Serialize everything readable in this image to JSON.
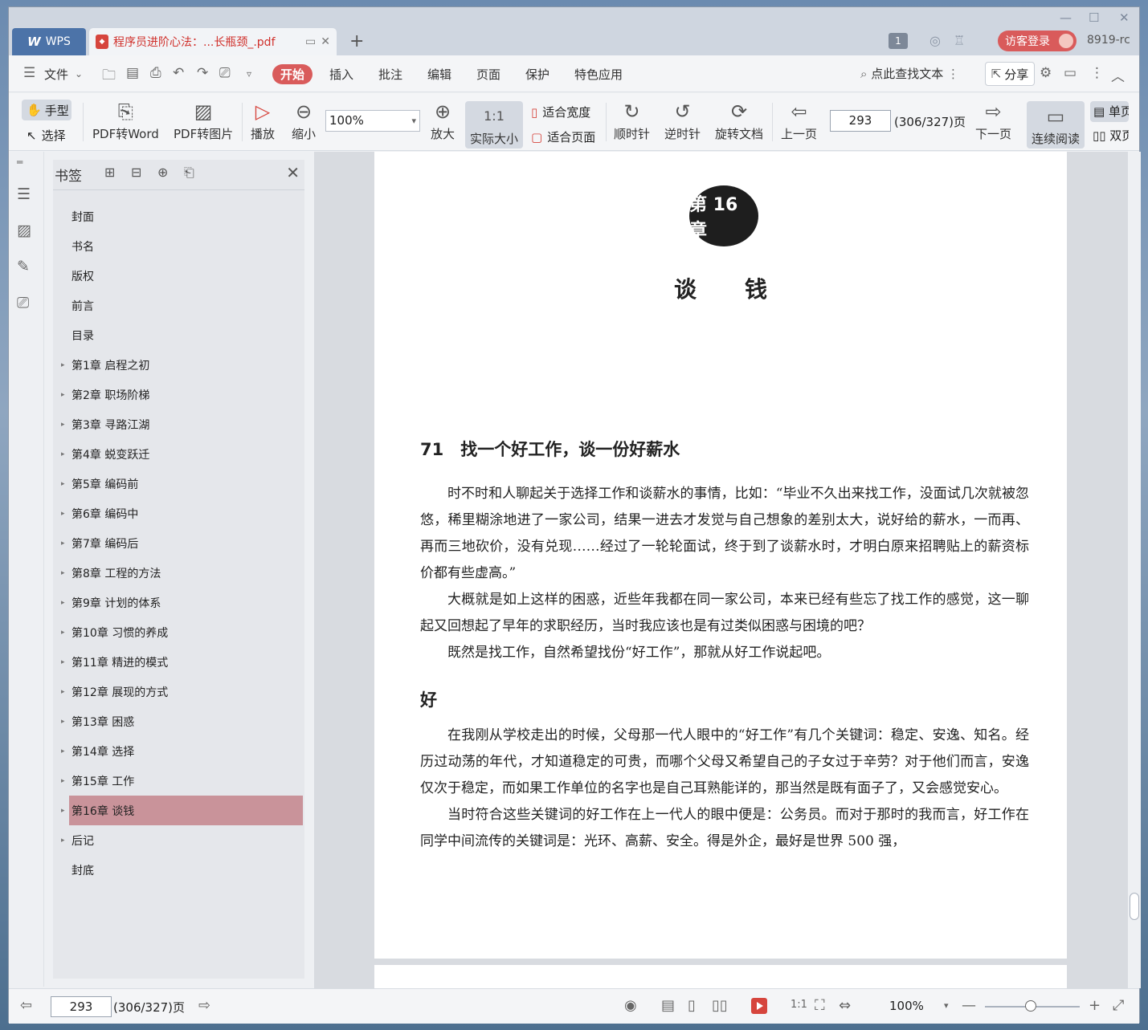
{
  "titlebar": {
    "app_tab": "WPS",
    "doc_tab_title": "程序员进阶心法：...长瓶颈_.pdf",
    "badge_count": "1",
    "visitor_login": "访客登录",
    "user_code": "8919-rc"
  },
  "menubar": {
    "file": "文件",
    "tabs": [
      "开始",
      "插入",
      "批注",
      "编辑",
      "页面",
      "保护",
      "特色应用"
    ],
    "search": "点此查找文本",
    "share": "分享"
  },
  "toolbar": {
    "hand": "手型",
    "select": "选择",
    "pdf_to_word": "PDF转Word",
    "pdf_to_image": "PDF转图片",
    "play": "播放",
    "zoom_out": "缩小",
    "zoom_value": "100%",
    "zoom_in": "放大",
    "actual_size": "实际大小",
    "fit_width": "适合宽度",
    "fit_page": "适合页面",
    "rotate_cw": "顺时针",
    "rotate_ccw": "逆时针",
    "rotate_doc": "旋转文档",
    "prev_page": "上一页",
    "page_input": "293",
    "page_total": "(306/327)页",
    "next_page": "下一页",
    "continuous": "连续阅读",
    "single": "单页",
    "double": "双页"
  },
  "panel": {
    "title": "书签",
    "items": [
      {
        "label": "封面",
        "expandable": false
      },
      {
        "label": "书名",
        "expandable": false
      },
      {
        "label": "版权",
        "expandable": false
      },
      {
        "label": "前言",
        "expandable": false
      },
      {
        "label": "目录",
        "expandable": false
      },
      {
        "label": "第1章 启程之初",
        "expandable": true
      },
      {
        "label": "第2章 职场阶梯",
        "expandable": true
      },
      {
        "label": "第3章 寻路江湖",
        "expandable": true
      },
      {
        "label": "第4章 蜕变跃迁",
        "expandable": true
      },
      {
        "label": "第5章 编码前",
        "expandable": true
      },
      {
        "label": "第6章 编码中",
        "expandable": true
      },
      {
        "label": "第7章 编码后",
        "expandable": true
      },
      {
        "label": "第8章 工程的方法",
        "expandable": true
      },
      {
        "label": "第9章 计划的体系",
        "expandable": true
      },
      {
        "label": "第10章 习惯的养成",
        "expandable": true
      },
      {
        "label": "第11章 精进的模式",
        "expandable": true
      },
      {
        "label": "第12章 展现的方式",
        "expandable": true
      },
      {
        "label": "第13章 困惑",
        "expandable": true
      },
      {
        "label": "第14章 选择",
        "expandable": true
      },
      {
        "label": "第15章 工作",
        "expandable": true
      },
      {
        "label": "第16章 谈钱",
        "expandable": true,
        "selected": true
      },
      {
        "label": "后记",
        "expandable": true
      },
      {
        "label": "封底",
        "expandable": false
      }
    ]
  },
  "page": {
    "chapter_badge": "第 16 章",
    "chapter_title": "谈钱",
    "section_title": "71　找一个好工作，谈一份好薪水",
    "paragraphs_1": [
      "时不时和人聊起关于选择工作和谈薪水的事情，比如：“毕业不久出来找工作，没面试几次就被忽悠，稀里糊涂地进了一家公司，结果一进去才发觉与自己想象的差别太大，说好给的薪水，一而再、再而三地砍价，没有兑现……经过了一轮轮面试，终于到了谈薪水时，才明白原来招聘贴上的薪资标价都有些虚高。”",
      "大概就是如上这样的困惑，近些年我都在同一家公司，本来已经有些忘了找工作的感觉，这一聊起又回想起了早年的求职经历，当时我应该也是有过类似困惑与困境的吧？",
      "既然是找工作，自然希望找份“好工作”，那就从好工作说起吧。"
    ],
    "subsection_title": "好",
    "paragraphs_2": [
      "在我刚从学校走出的时候，父母那一代人眼中的“好工作”有几个关键词：稳定、安逸、知名。经历过动荡的年代，才知道稳定的可贵，而哪个父母又希望自己的子女过于辛劳？对于他们而言，安逸仅次于稳定，而如果工作单位的名字也是自己耳熟能详的，那当然是既有面子了，又会感觉安心。",
      "当时符合这些关键词的好工作在上一代人的眼中便是：公务员。而对于那时的我而言，好工作在同学中间流传的关键词是：光环、高薪、安全。得是外企，最好是世界 500 强，"
    ]
  },
  "status": {
    "page_input": "293",
    "page_total": "(306/327)页",
    "zoom": "100%",
    "zoom_level_fraction": 0.48
  }
}
